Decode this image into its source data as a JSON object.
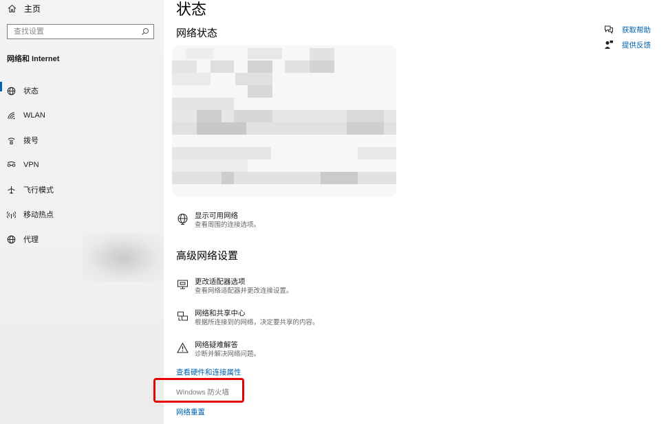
{
  "sidebar": {
    "home_label": "主页",
    "search_placeholder": "查找设置",
    "section_label": "网络和 Internet",
    "items": [
      {
        "label": "状态",
        "icon": "globe-status-icon",
        "active": true
      },
      {
        "label": "WLAN",
        "icon": "wifi-icon"
      },
      {
        "label": "拨号",
        "icon": "dialup-icon"
      },
      {
        "label": "VPN",
        "icon": "vpn-icon"
      },
      {
        "label": "飞行模式",
        "icon": "airplane-icon"
      },
      {
        "label": "移动热点",
        "icon": "hotspot-icon"
      },
      {
        "label": "代理",
        "icon": "proxy-globe-icon"
      }
    ]
  },
  "main": {
    "title": "状态",
    "network_status_heading": "网络状态",
    "show_networks": {
      "title": "显示可用网络",
      "desc": "查看周围的连接选项。"
    },
    "advanced_heading": "高级网络设置",
    "options": [
      {
        "title": "更改适配器选项",
        "desc": "查看网络适配器并更改连接设置。",
        "icon": "adapter-monitor-icon"
      },
      {
        "title": "网络和共享中心",
        "desc": "根据所连接到的网络，决定要共享的内容。",
        "icon": "sharing-center-icon"
      },
      {
        "title": "网络疑难解答",
        "desc": "诊断并解决网络问题。",
        "icon": "warning-triangle-icon"
      }
    ],
    "links": {
      "hardware": "查看硬件和连接属性",
      "firewall": "Windows 防火墙",
      "reset": "网络重置"
    }
  },
  "right": {
    "help": "获取帮助",
    "feedback": "提供反馈"
  },
  "colors": {
    "accent": "#0063b1",
    "highlight_box": "#e60000"
  }
}
